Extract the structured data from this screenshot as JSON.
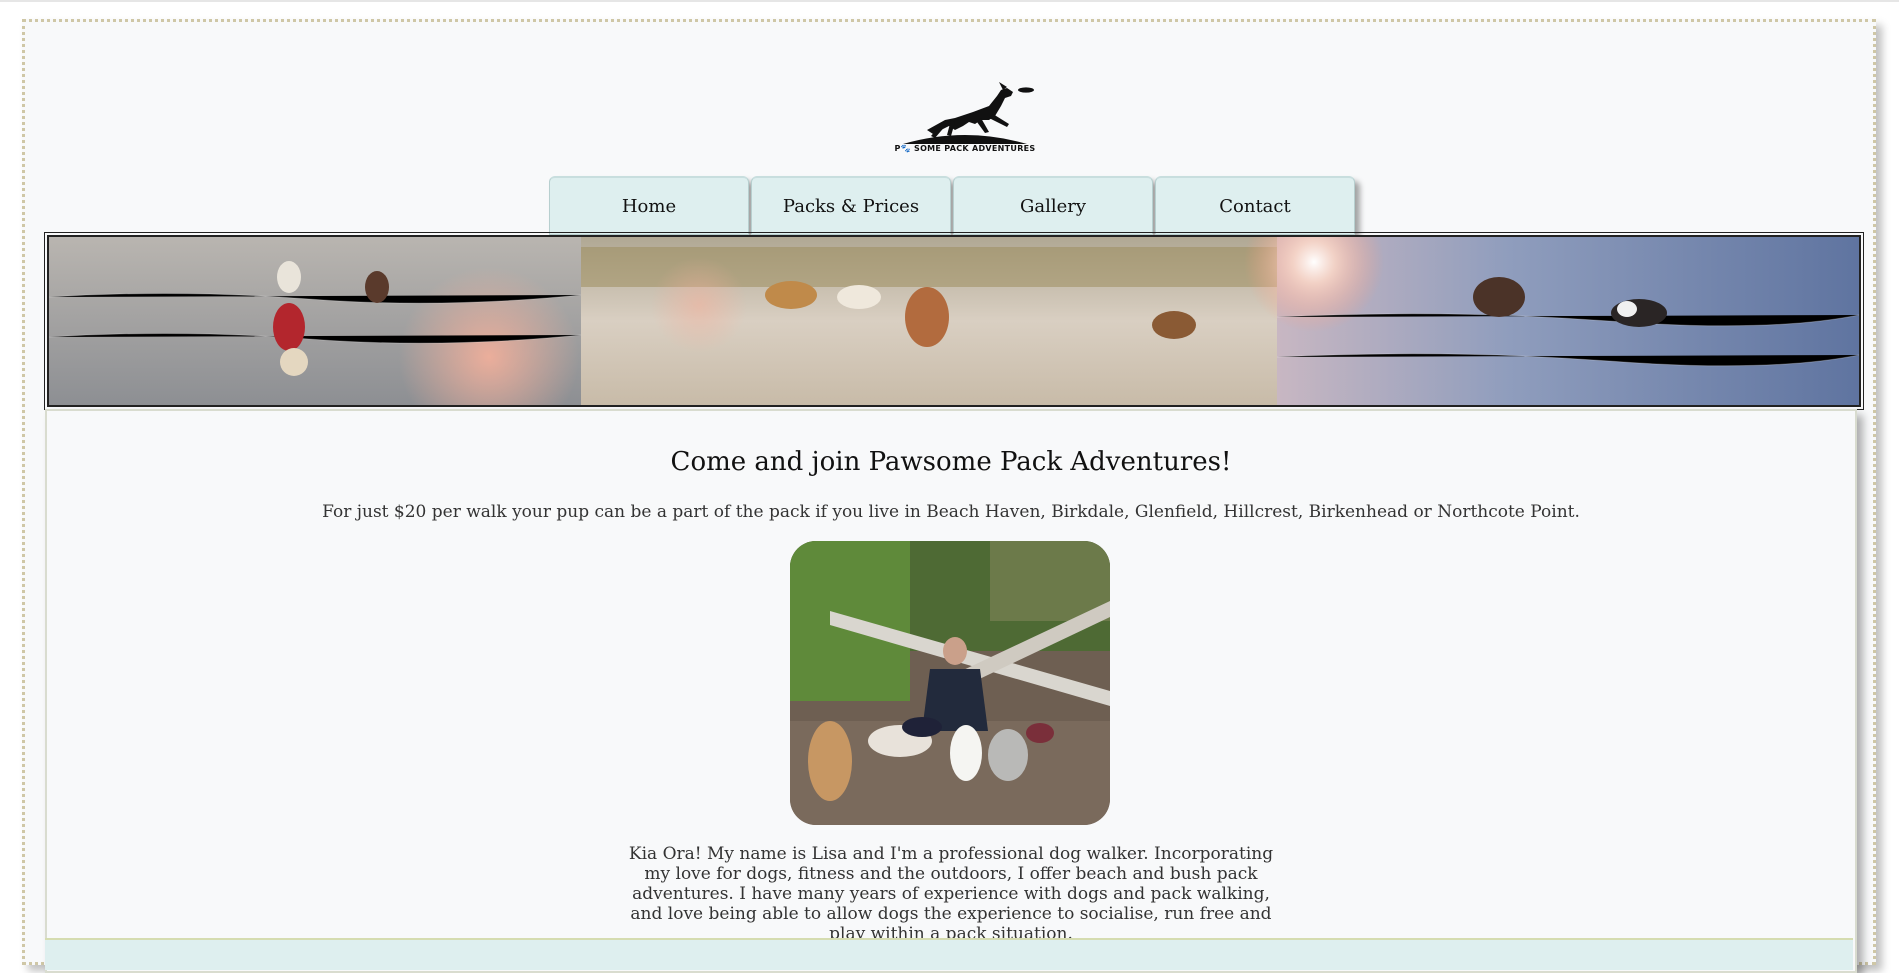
{
  "logo": {
    "text": "P🐾 SOME PACK ADVENTURES",
    "icon": "leaping-dog-frisbee-logo"
  },
  "nav": {
    "items": [
      {
        "label": "Home"
      },
      {
        "label": "Packs & Prices"
      },
      {
        "label": "Gallery"
      },
      {
        "label": "Contact"
      }
    ]
  },
  "banner": {
    "description": "beach-dogs-panorama"
  },
  "main": {
    "heading": "Come and join Pawsome Pack Adventures!",
    "intro": "For just $20 per walk your pup can be a part of the pack if you live in Beach Haven, Birkdale, Glenfield, Hillcrest, Birkenhead or Northcote Point.",
    "bio": "Kia Ora! My name is Lisa and I'm a professional dog walker. Incorporating my love for dogs, fitness and the outdoors, I offer beach and bush pack adventures. I have many years of experience with dogs and pack walking, and love being able to allow dogs the experience to socialise, run free and play within a pack situation."
  },
  "colors": {
    "nav_bg": "#deefef",
    "page_bg": "#f8f9fa",
    "border_dotted": "#cfc7a6"
  }
}
